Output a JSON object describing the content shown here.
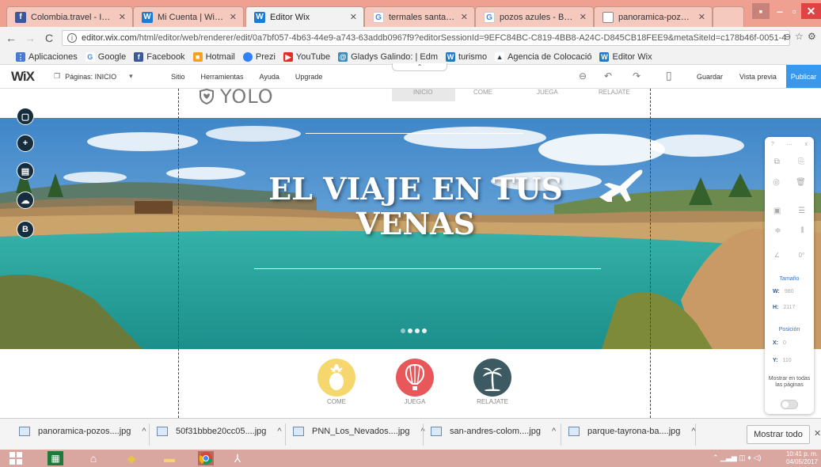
{
  "browser": {
    "tabs": [
      {
        "title": "Colombia.travel - Inicio",
        "icon": "facebook-icon"
      },
      {
        "title": "Mi Cuenta | Wix.com",
        "icon": "wix-icon"
      },
      {
        "title": "Editor Wix",
        "icon": "wix-icon",
        "active": true
      },
      {
        "title": "termales santa rosa - Bu",
        "icon": "google-icon"
      },
      {
        "title": "pozos azules - Buscar co",
        "icon": "google-icon"
      },
      {
        "title": "panoramica-pozos-azule",
        "icon": "document-icon"
      }
    ],
    "url_main": "editor.wix.com",
    "url_rest": "/html/editor/web/renderer/edit/0a7bf057-4b63-44e9-a743-63addb0967f9?editorSessionId=9EFC84BC-C819-4BB8-A24C-D845CB18FEE9&metaSiteId=c178b46f-0051-4",
    "bookmarks": [
      "Aplicaciones",
      "Google",
      "Facebook",
      "Hotmail",
      "Prezi",
      "YouTube",
      "Gladys Galindo: | Edm",
      "turismo",
      "Agencia de Colocació",
      "Editor Wix"
    ]
  },
  "wix": {
    "logo": "WiX",
    "pages_label": "Páginas: INICIO",
    "menu": [
      "Sitio",
      "Herramientas",
      "Ayuda",
      "Upgrade"
    ],
    "save": "Guardar",
    "preview": "Vista previa",
    "publish": "Publicar"
  },
  "site": {
    "logo_text": "YOLO",
    "nav": [
      "INICIO",
      "COME",
      "JUEGA",
      "RELAJATE"
    ],
    "hero_title": "EL VIAJE EN TUS VENAS",
    "circles": [
      {
        "label": "COME",
        "color": "#f5d76e",
        "icon": "pineapple-icon"
      },
      {
        "label": "JUEGA",
        "color": "#e8585a",
        "icon": "hot-air-balloon-icon"
      },
      {
        "label": "RELAJATE",
        "color": "#3d5a63",
        "icon": "palm-tree-icon"
      }
    ]
  },
  "left_tools": [
    "pages-icon",
    "add-icon",
    "background-icon",
    "upload-icon",
    "blog-icon"
  ],
  "panel": {
    "help": "?",
    "close": "x",
    "angle": "0°",
    "size_title": "Tamaño",
    "w_label": "W:",
    "w_value": "980",
    "h_label": "H:",
    "h_value": "2117",
    "pos_title": "Posición",
    "x_label": "X:",
    "x_value": "0",
    "y_label": "Y:",
    "y_value": "110",
    "show_all": "Mostrar en todas las páginas"
  },
  "downloads": [
    "panoramica-pozos....jpg",
    "50f31bbbe20cc05....jpg",
    "PNN_Los_Nevados....jpg",
    "san-andres-colom....jpg",
    "parque-tayrona-ba....jpg"
  ],
  "show_all": "Mostrar todo",
  "clock": {
    "time": "10:41 p. m.",
    "date": "04/05/2017"
  }
}
